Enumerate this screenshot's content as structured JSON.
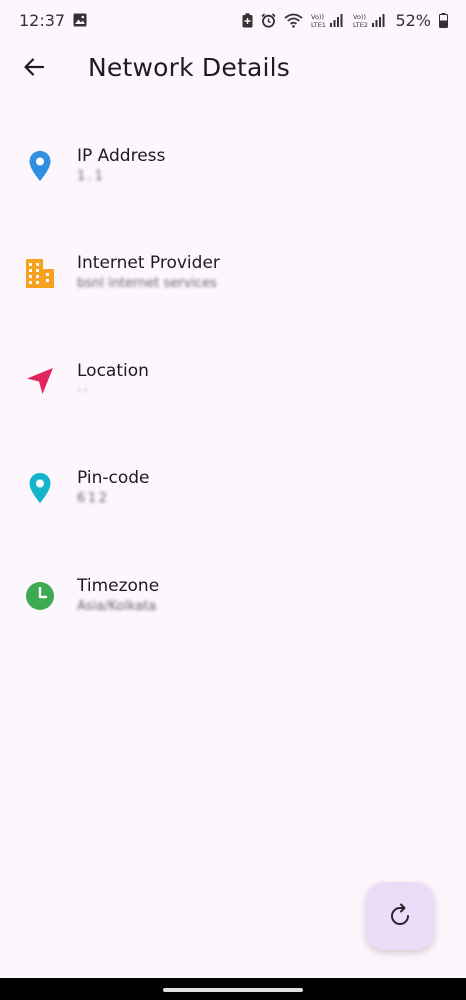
{
  "status_bar": {
    "time": "12:37",
    "battery": "52%",
    "sim1": "Vo)) LTE1",
    "sim2": "Vo)) LTE2"
  },
  "header": {
    "title": "Network Details"
  },
  "items": [
    {
      "title": "IP Address",
      "value": "1 . 1",
      "icon": "location-pin-icon",
      "color": "#2f8fe0"
    },
    {
      "title": "Internet Provider",
      "value": "bsnl  internet  services",
      "icon": "building-icon",
      "color": "#f6a21f"
    },
    {
      "title": "Location",
      "value": "· ·",
      "icon": "navigation-arrow-icon",
      "color": "#e0245e"
    },
    {
      "title": "Pin-code",
      "value": "6 1 2",
      "icon": "location-pin-icon",
      "color": "#15b6cc"
    },
    {
      "title": "Timezone",
      "value": "Asia/Kolkata",
      "icon": "clock-icon",
      "color": "#3daa4f"
    }
  ],
  "fab": {
    "icon": "refresh-icon",
    "color": "#ecdcf8"
  }
}
